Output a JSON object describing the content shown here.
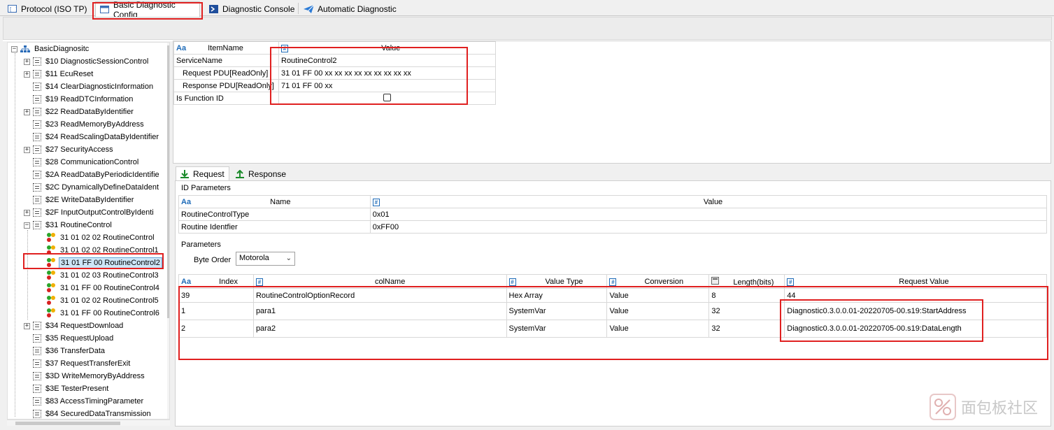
{
  "tabs": [
    {
      "label": "Protocol (ISO TP)",
      "icon": "protocol-icon"
    },
    {
      "label": "Basic Diagnostic Config",
      "icon": "window-icon"
    },
    {
      "label": "Diagnostic Console",
      "icon": "console-icon"
    },
    {
      "label": "Automatic Diagnostic",
      "icon": "send-icon"
    }
  ],
  "tree": {
    "root": "BasicDiagnositc",
    "items": [
      {
        "label": "$10 DiagnosticSessionControl",
        "expandable": true
      },
      {
        "label": "$11 EcuReset",
        "expandable": true
      },
      {
        "label": "$14 ClearDiagnosticInformation",
        "expandable": false
      },
      {
        "label": "$19 ReadDTCInformation",
        "expandable": false
      },
      {
        "label": "$22 ReadDataByIdentifier",
        "expandable": true
      },
      {
        "label": "$23 ReadMemoryByAddress",
        "expandable": false
      },
      {
        "label": "$24 ReadScalingDataByIdentifier",
        "expandable": false
      },
      {
        "label": "$27 SecurityAccess",
        "expandable": true
      },
      {
        "label": "$28 CommunicationControl",
        "expandable": false
      },
      {
        "label": "$2A ReadDataByPeriodicIdentifie",
        "expandable": false
      },
      {
        "label": "$2C DynamicallyDefineDataIdent",
        "expandable": false
      },
      {
        "label": "$2E WriteDataByIdentifier",
        "expandable": false
      },
      {
        "label": "$2F InputOutputControlByIdenti",
        "expandable": true
      },
      {
        "label": "$31 RoutineControl",
        "expandable": true,
        "expanded": true
      }
    ],
    "children": [
      {
        "label": "31 01 02 02 RoutineControl"
      },
      {
        "label": "31 01 02 02 RoutineControl1"
      },
      {
        "label": "31 01 FF 00 RoutineControl2",
        "selected": true
      },
      {
        "label": "31 01 02 03 RoutineControl3"
      },
      {
        "label": "31 01 FF 00 RoutineControl4"
      },
      {
        "label": "31 01 02 02 RoutineControl5"
      },
      {
        "label": "31 01 FF 00 RoutineControl6"
      }
    ],
    "items_after": [
      {
        "label": "$34 RequestDownload",
        "expandable": true
      },
      {
        "label": "$35 RequestUpload",
        "expandable": false
      },
      {
        "label": "$36 TransferData",
        "expandable": false
      },
      {
        "label": "$37 RequestTransferExit",
        "expandable": false
      },
      {
        "label": "$3D WriteMemoryByAddress",
        "expandable": false
      },
      {
        "label": "$3E TesterPresent",
        "expandable": false
      },
      {
        "label": "$83 AccessTimingParameter",
        "expandable": false
      },
      {
        "label": "$84 SecuredDataTransmission",
        "expandable": false
      }
    ]
  },
  "props": {
    "col_name": "ItemName",
    "col_value": "Value",
    "aa": "Aa",
    "hash": "#",
    "rows": [
      {
        "name": "ServiceName",
        "value": "RoutineControl2",
        "indent": false
      },
      {
        "name": "Request  PDU[ReadOnly]",
        "value": "31 01 FF 00 xx xx xx xx xx xx xx xx xx",
        "indent": true
      },
      {
        "name": "Response PDU[ReadOnly]",
        "value": "71 01 FF 00 xx",
        "indent": true
      },
      {
        "name": "Is Function ID",
        "value": "",
        "checkbox": true,
        "checked": false
      }
    ]
  },
  "subtabs": {
    "request": "Request",
    "response": "Response"
  },
  "id_params": {
    "title": "ID Parameters",
    "col_name": "Name",
    "col_value": "Value",
    "rows": [
      {
        "name": "RoutineControlType",
        "value": "0x01"
      },
      {
        "name": "Routine Identfier",
        "value": "0xFF00"
      }
    ]
  },
  "parameters": {
    "title": "Parameters",
    "byte_order_label": "Byte Order",
    "byte_order_value": "Motorola",
    "columns": [
      "Index",
      "colName",
      "Value Type",
      "Conversion",
      "Length(bits)",
      "Request Value"
    ],
    "rows": [
      {
        "index": "39",
        "colName": "RoutineControlOptionRecord",
        "valueType": "Hex Array",
        "conversion": "Value",
        "length": "8",
        "requestValue": "44"
      },
      {
        "index": "1",
        "colName": "para1",
        "valueType": "SystemVar",
        "conversion": "Value",
        "length": "32",
        "requestValue": "Diagnostic0.3.0.0.01-20220705-00.s19:StartAddress"
      },
      {
        "index": "2",
        "colName": "para2",
        "valueType": "SystemVar",
        "conversion": "Value",
        "length": "32",
        "requestValue": "Diagnostic0.3.0.0.01-20220705-00.s19:DataLength"
      }
    ]
  },
  "watermark": "面包板社区",
  "colors": {
    "highlight_red": "#e02020",
    "selection": "#cde6f7",
    "accent_blue": "#1e6bb8"
  }
}
